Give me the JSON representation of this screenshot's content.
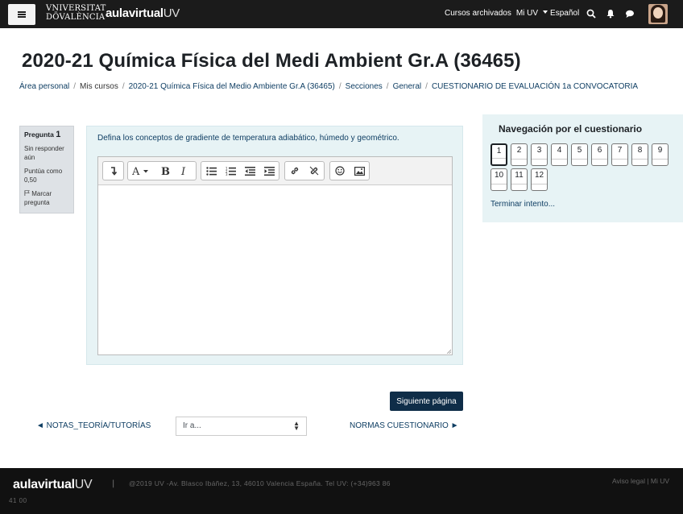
{
  "header": {
    "menu_icon": "hamburger-icon",
    "uv_logo_line1": "VNIVERSITAT",
    "uv_logo_line2": "DÖVALÈNCIA",
    "aula_logo_main": "aulavirtual",
    "aula_logo_suffix": "UV",
    "links": [
      "Cursos archivados",
      "Mi UV"
    ],
    "language": "Español",
    "icons": [
      "search-icon",
      "bell-icon",
      "chat-icon"
    ]
  },
  "page": {
    "title": "2020-21 Química Física del Medi Ambient Gr.A (36465)"
  },
  "breadcrumb": [
    "Área personal",
    "Mis cursos",
    "2020-21 Química Física del Medio Ambiente Gr.A (36465)",
    "Secciones",
    "General",
    "CUESTIONARIO DE EVALUACIÓN 1a CONVOCATORIA"
  ],
  "question_info": {
    "label": "Pregunta",
    "number": "1",
    "status": "Sin responder aún",
    "score": "Puntúa como 0,50",
    "flag": "Marcar pregunta"
  },
  "question": {
    "text": "Defina los conceptos de gradiente de temperatura adiabático, húmedo y geométrico.",
    "toolbar_icons": [
      "show-more-icon",
      "font-color-icon",
      "bold-icon",
      "italic-icon",
      "unordered-list-icon",
      "ordered-list-icon",
      "outdent-icon",
      "indent-icon",
      "link-icon",
      "unlink-icon",
      "emoji-icon",
      "image-icon"
    ],
    "answer": ""
  },
  "navigation": {
    "next_button": "Siguiente página",
    "prev_link": "◄ NOTAS_TEORÍA/TUTORÍAS",
    "goto_placeholder": "Ir a...",
    "next_link": "NORMAS CUESTIONARIO ►"
  },
  "quiz_nav": {
    "title": "Navegación por el cuestionario",
    "questions": [
      "1",
      "2",
      "3",
      "4",
      "5",
      "6",
      "7",
      "8",
      "9",
      "10",
      "11",
      "12"
    ],
    "current": "1",
    "finish": "Terminar intento..."
  },
  "footer": {
    "logo_main": "aulavirtual",
    "logo_suffix": "UV",
    "separator": "|",
    "address": "@2019 UV -Av. Blasco Ibáñez, 13, 46010 Valencia España. Tel UV: (+34)963 86",
    "address_cont": "41 00",
    "right_links": "Aviso legal | Mi UV"
  },
  "colors": {
    "topbar": "#1b1b1b",
    "primary": "#0f2d48",
    "link": "#0f3e63",
    "panel": "#e7f3f5"
  }
}
